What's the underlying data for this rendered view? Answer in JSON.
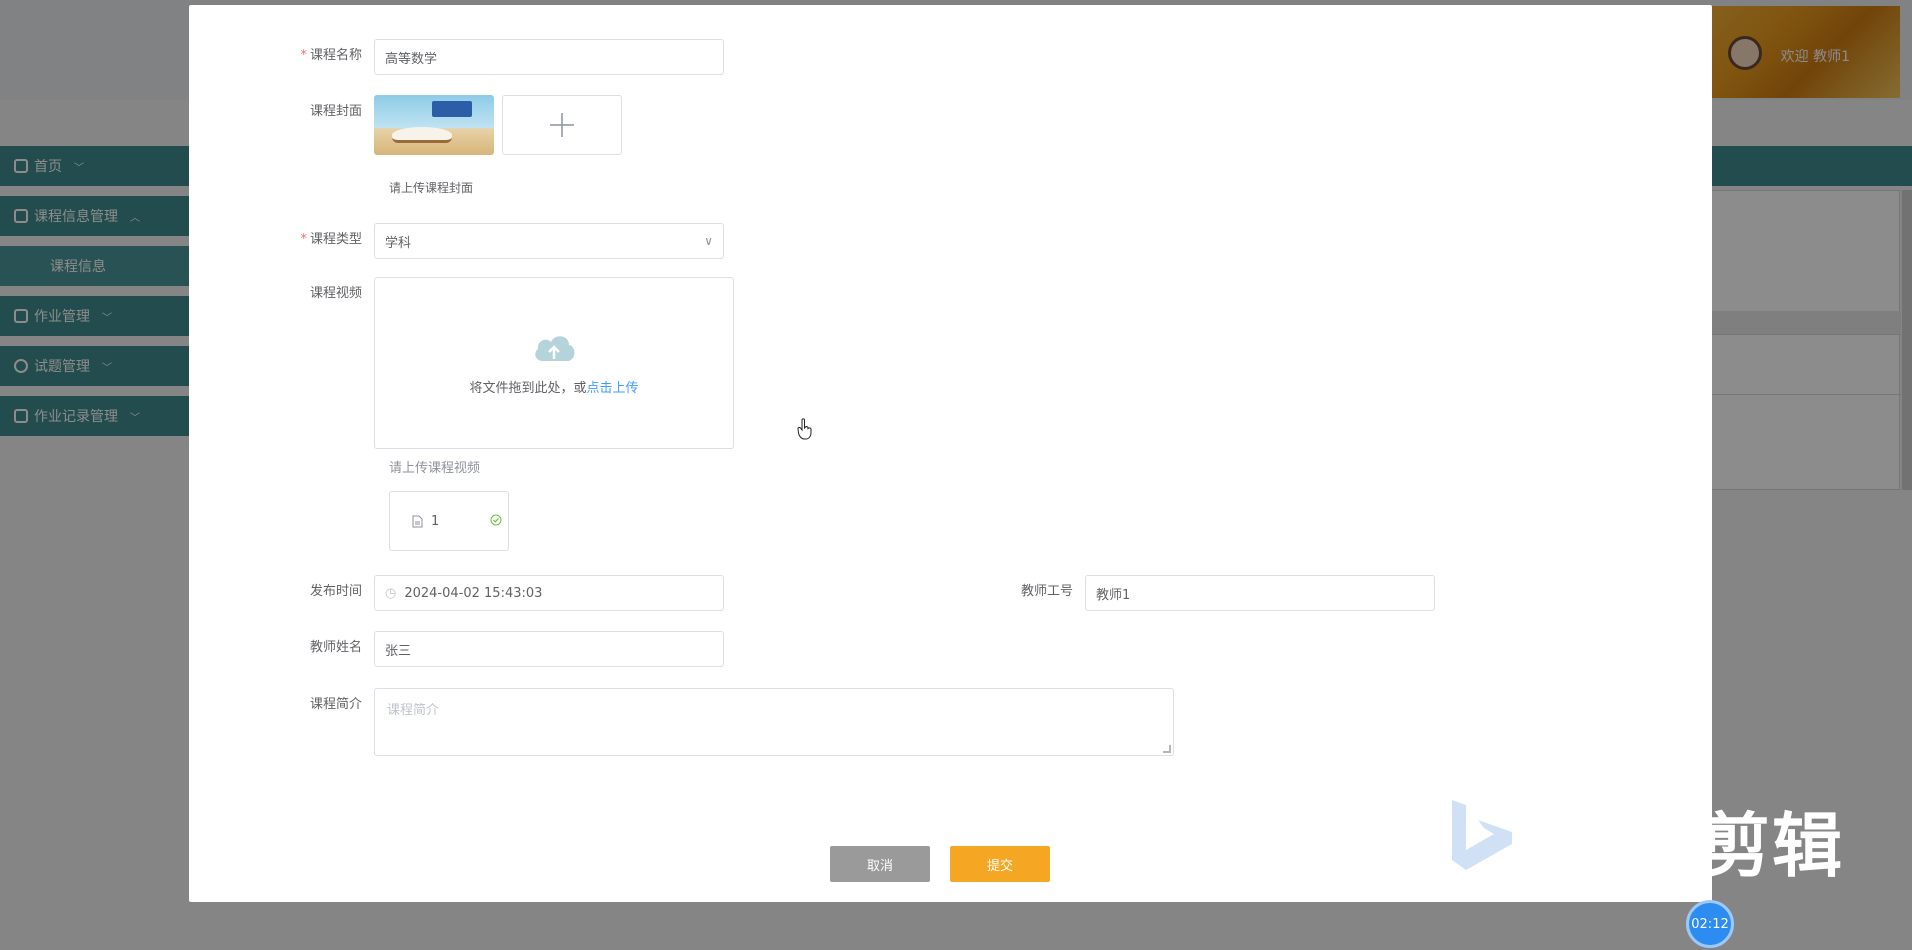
{
  "background": {
    "welcome": "欢迎 教师1",
    "sidebar": [
      {
        "label": "首页",
        "icon": "home-icon"
      },
      {
        "label": "课程信息管理",
        "icon": "grid-icon"
      },
      {
        "label": "课程信息",
        "icon": ""
      },
      {
        "label": "作业管理",
        "icon": "stack-icon"
      },
      {
        "label": "试题管理",
        "icon": "check-circle-icon"
      },
      {
        "label": "作业记录管理",
        "icon": "book-icon"
      }
    ]
  },
  "form": {
    "course_name": {
      "label": "课程名称",
      "value": "高等数学"
    },
    "cover": {
      "label": "课程封面",
      "tip": "请上传课程封面"
    },
    "course_type": {
      "label": "课程类型",
      "value": "学科"
    },
    "video": {
      "label": "课程视频",
      "drag_text": "将文件拖到此处，或",
      "drag_link": "点击上传",
      "tip": "请上传课程视频",
      "file_name": "1"
    },
    "publish_time": {
      "label": "发布时间",
      "value": "2024-04-02 15:43:03"
    },
    "teacher_id": {
      "label": "教师工号",
      "value": "教师1"
    },
    "teacher_name": {
      "label": "教师姓名",
      "value": "张三"
    },
    "intro": {
      "label": "课程简介",
      "placeholder": "课程简介"
    },
    "buttons": {
      "cancel": "取消",
      "submit": "提交"
    }
  },
  "watermark": {
    "text": "剪辑",
    "timer": "02:12"
  },
  "colors": {
    "accent": "#409eff",
    "submit": "#f5a623",
    "cancel": "#9a9a9a",
    "required": "#f56c6c",
    "sidebar": "#3f8a8c"
  }
}
